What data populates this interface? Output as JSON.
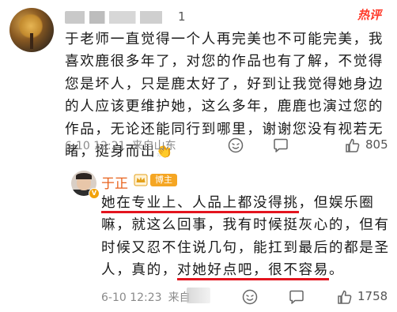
{
  "top_comment": {
    "name_suffix": "1",
    "hot_badge": "热评",
    "text": "于老师一直觉得一个人再完美也不可能完美，我喜欢鹿很多年了，对您的作品也有了解，不觉得您是坏人，只是鹿太好了，好到让我觉得她身边的人应该更维护她，这么多年，鹿鹿也演过您的作品，无论还能同行到哪里，谢谢您没有视若无睹，挺身而出",
    "clap": "👏",
    "date": "6-10 12:21",
    "location": "来自山东",
    "like_count": "805",
    "icons": [
      "emoji-icon",
      "comment-icon",
      "like-icon"
    ]
  },
  "reply": {
    "name": "于正",
    "badge": "博主",
    "verified_icon": "v-badge-icon",
    "text_part1": "她在专业上、人品上都没得挑",
    "text_part2": "，但娱乐圈嘛，就这么回事，我有时候挺灰心的，但有时候又忍不住说几句，能扛到最后的都是圣人，真的，",
    "text_part3": "对她好点吧，很不容易",
    "text_part4": "。",
    "date": "6-10 12:23",
    "location": "来自",
    "like_count": "1758",
    "highlight_color": "#e3141e"
  }
}
